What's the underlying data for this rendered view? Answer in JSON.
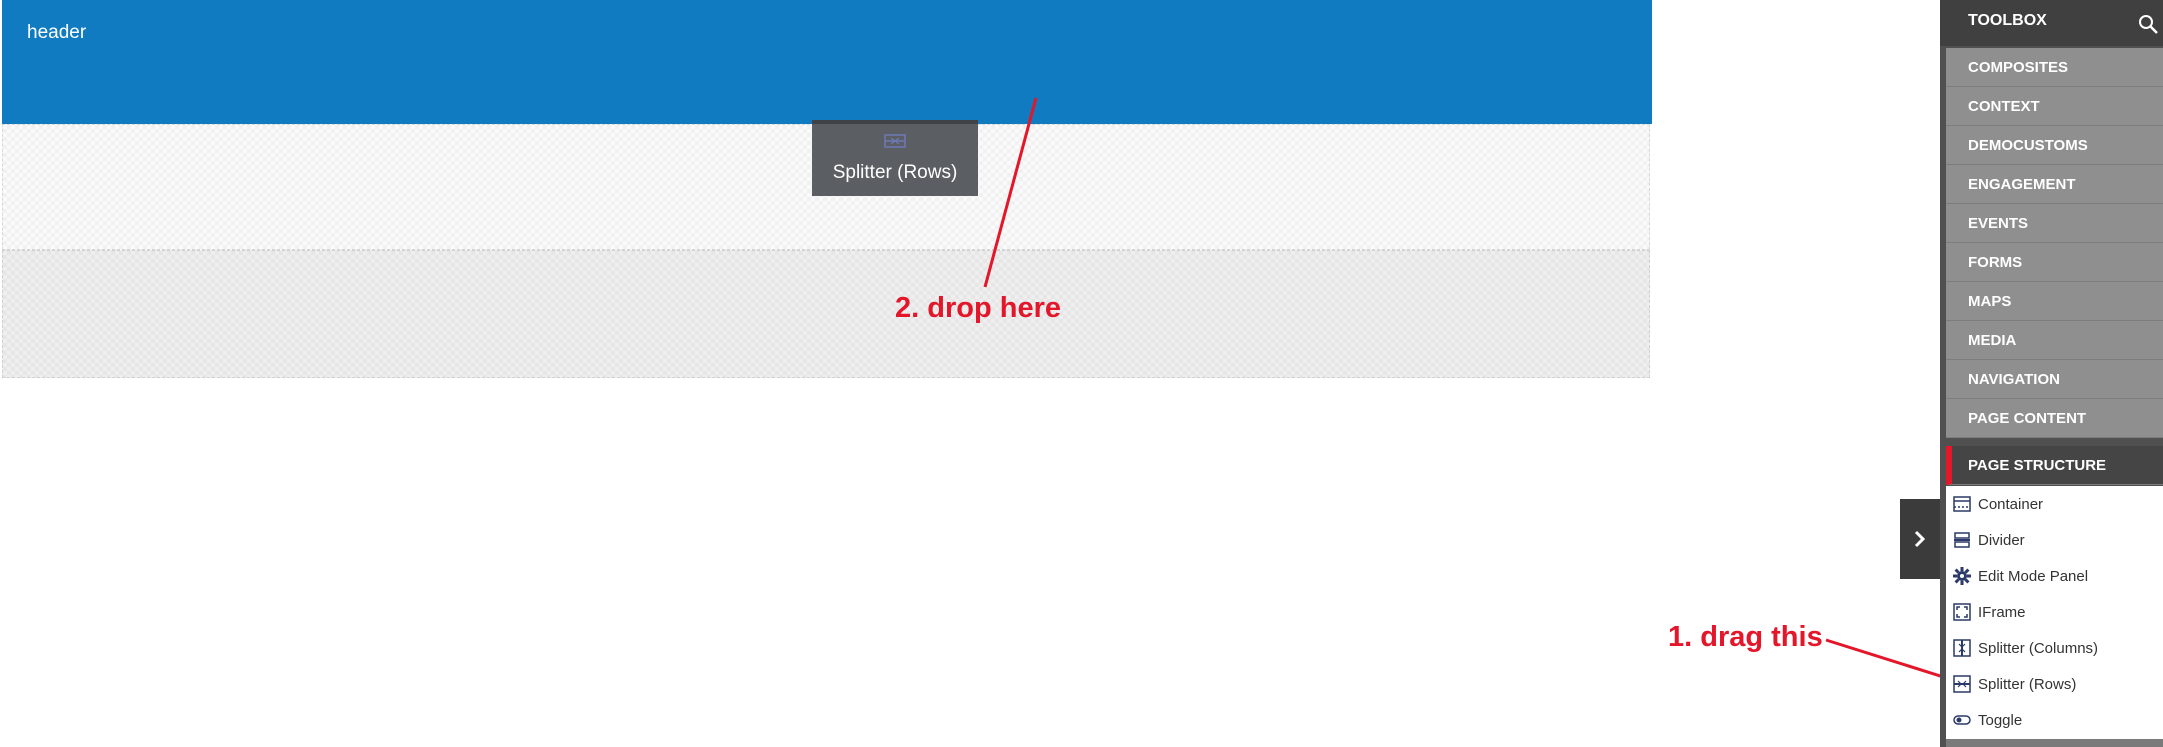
{
  "canvas": {
    "header_label": "header",
    "drag_ghost_label": "Splitter (Rows)"
  },
  "annotations": {
    "drop": "2. drop here",
    "drag": "1. drag this",
    "color": "#e3162a"
  },
  "toolbox": {
    "title": "TOOLBOX",
    "search_icon": "search-icon",
    "categories": [
      {
        "label": "COMPOSITES"
      },
      {
        "label": "CONTEXT"
      },
      {
        "label": "DEMOCUSTOMS"
      },
      {
        "label": "ENGAGEMENT"
      },
      {
        "label": "EVENTS"
      },
      {
        "label": "FORMS"
      },
      {
        "label": "MAPS"
      },
      {
        "label": "MEDIA"
      },
      {
        "label": "NAVIGATION"
      },
      {
        "label": "PAGE CONTENT"
      },
      {
        "label": "PAGE STRUCTURE",
        "active": true
      }
    ],
    "items": [
      {
        "label": "Container",
        "icon": "container-icon"
      },
      {
        "label": "Divider",
        "icon": "divider-icon"
      },
      {
        "label": "Edit Mode Panel",
        "icon": "gear-icon"
      },
      {
        "label": "IFrame",
        "icon": "iframe-icon"
      },
      {
        "label": "Splitter (Columns)",
        "icon": "splitter-columns-icon"
      },
      {
        "label": "Splitter (Rows)",
        "icon": "splitter-rows-icon"
      },
      {
        "label": "Toggle",
        "icon": "toggle-icon"
      }
    ]
  },
  "colors": {
    "header_blue": "#107bc1",
    "toolbox_dark": "#404040",
    "category_gray": "#8f8f8f",
    "active_marker": "#e3162a",
    "icon_navy": "#2b3a67"
  }
}
